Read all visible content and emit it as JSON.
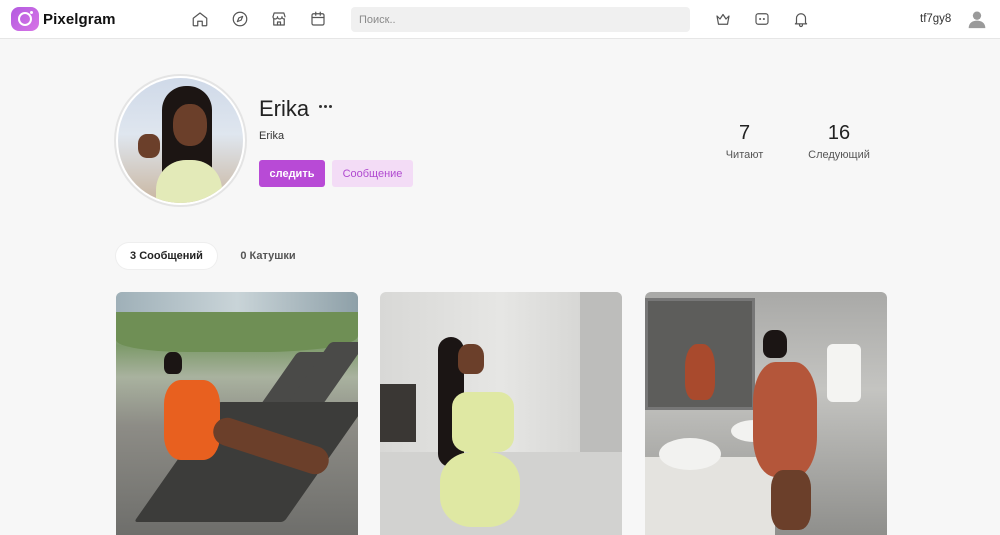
{
  "app": {
    "name": "Pixelgram"
  },
  "search": {
    "placeholder": "Поиск.."
  },
  "nav_icons": [
    "home-icon",
    "compass-icon",
    "store-icon",
    "calendar-icon",
    "crown-icon",
    "chat-icon",
    "bell-icon",
    "user-icon"
  ],
  "current_user": {
    "username": "tf7gy8"
  },
  "profile": {
    "name": "Erika",
    "handle": "Erika",
    "follow_label": "следить",
    "message_label": "Сообщение",
    "stats": {
      "followers_count": "7",
      "followers_label": "Читают",
      "following_count": "16",
      "following_label": "Следующий"
    }
  },
  "tabs": [
    {
      "label": "3 Сообщений",
      "active": true
    },
    {
      "label": "0 Катушки",
      "active": false
    }
  ],
  "posts": [
    {
      "scene": "woman in orange outfit on sun lounger"
    },
    {
      "scene": "woman in light green outfit in kitchen"
    },
    {
      "scene": "woman in patterned dress at bathroom mirror"
    }
  ],
  "colors": {
    "accent": "#b84ad6",
    "accent_soft": "#f3dcf6",
    "background": "#f7f7f7"
  }
}
